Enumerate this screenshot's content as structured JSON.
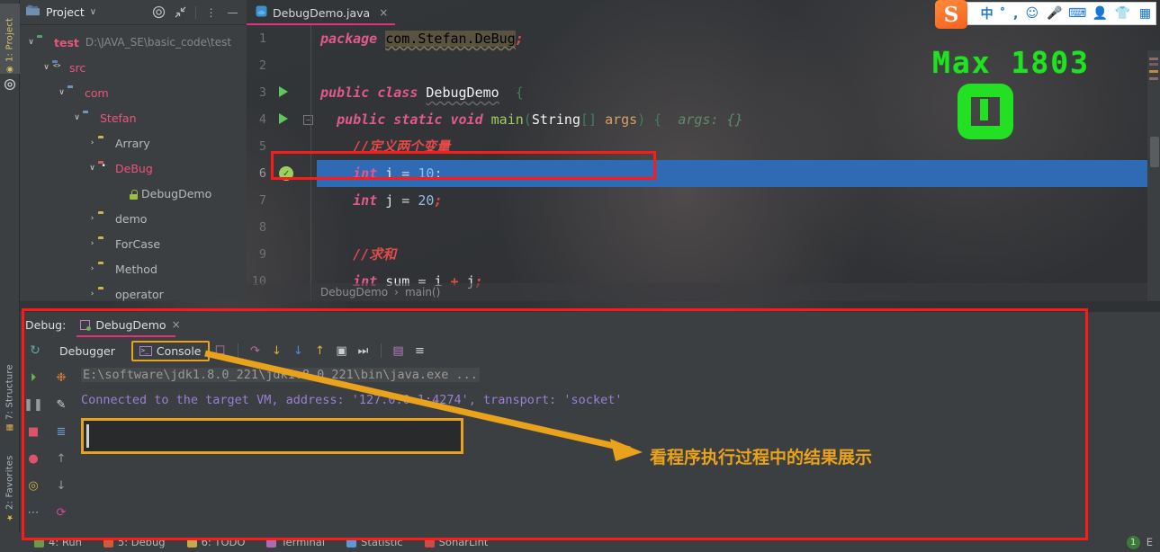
{
  "left_strip": {
    "tabs": [
      {
        "label": "1: Project",
        "icon": "project-icon"
      },
      {
        "label": "7: Structure",
        "icon": "structure-icon"
      },
      {
        "label": "2: Favorites",
        "icon": "star-icon"
      }
    ]
  },
  "project_panel": {
    "title": "Project",
    "caret": "∨",
    "header_icons": [
      "target-icon",
      "collapse-all-icon",
      "more-options-icon",
      "hide-icon"
    ],
    "tree": [
      {
        "arrow": "∨",
        "icon": "folder-green",
        "label": "test",
        "sub": "D:\\JAVA_SE\\basic_code\\test",
        "indent": 0,
        "color": "c-test"
      },
      {
        "arrow": "∨",
        "icon": "folder-src",
        "label": "src",
        "sub": "",
        "indent": 1,
        "color": "c-src"
      },
      {
        "arrow": "∨",
        "icon": "folder-blue",
        "label": "com",
        "sub": "",
        "indent": 2,
        "color": "c-com"
      },
      {
        "arrow": "∨",
        "icon": "folder-blue",
        "label": "Stefan",
        "sub": "",
        "indent": 3,
        "color": "c-stefan"
      },
      {
        "arrow": "›",
        "icon": "folder-yellow",
        "label": "Arrary",
        "sub": "",
        "indent": 4,
        "color": "c-plain"
      },
      {
        "arrow": "∨",
        "icon": "folder-red",
        "label": "DeBug",
        "sub": "",
        "indent": 4,
        "color": "c-debug"
      },
      {
        "arrow": "",
        "icon": "java-class",
        "label": "DebugDemo",
        "sub": "",
        "indent": 5,
        "color": "c-grey",
        "lock": true
      },
      {
        "arrow": "›",
        "icon": "folder-yellow",
        "label": "demo",
        "sub": "",
        "indent": 4,
        "color": "c-plain"
      },
      {
        "arrow": "›",
        "icon": "folder-yellow",
        "label": "ForCase",
        "sub": "",
        "indent": 4,
        "color": "c-plain"
      },
      {
        "arrow": "›",
        "icon": "folder-yellow",
        "label": "Method",
        "sub": "",
        "indent": 4,
        "color": "c-plain"
      },
      {
        "arrow": "›",
        "icon": "folder-yellow",
        "label": "operator",
        "sub": "",
        "indent": 4,
        "color": "c-plain"
      }
    ]
  },
  "editor": {
    "tab": {
      "label": "DebugDemo.java",
      "close": "×",
      "icon": "java-file-icon"
    },
    "breadcrumb": {
      "class": "DebugDemo",
      "sep": "›",
      "method": "main()"
    },
    "current_line": 6,
    "lines": [
      {
        "n": "1",
        "gutter": "",
        "tokens": [
          {
            "t": "package",
            "c": "kw"
          },
          {
            "t": " ",
            "c": "punc"
          },
          {
            "t": "com.Stefan.DeBug",
            "c": "pkg-hl"
          },
          {
            "t": ";",
            "c": "cmt"
          }
        ]
      },
      {
        "n": "2",
        "gutter": "",
        "tokens": []
      },
      {
        "n": "3",
        "gutter": "run",
        "tokens": [
          {
            "t": "public",
            "c": "kw"
          },
          {
            "t": " ",
            "c": "punc"
          },
          {
            "t": "class",
            "c": "kw"
          },
          {
            "t": " ",
            "c": "punc"
          },
          {
            "t": "DebugDemo",
            "c": "cls wavy"
          },
          {
            "t": "  ",
            "c": "punc"
          },
          {
            "t": "{",
            "c": "paren"
          }
        ]
      },
      {
        "n": "4",
        "gutter": "run-fold",
        "tokens": [
          {
            "t": "  ",
            "c": "punc"
          },
          {
            "t": "public",
            "c": "kw"
          },
          {
            "t": " ",
            "c": "punc"
          },
          {
            "t": "static",
            "c": "kw"
          },
          {
            "t": " ",
            "c": "punc"
          },
          {
            "t": "void",
            "c": "kw"
          },
          {
            "t": " ",
            "c": "punc"
          },
          {
            "t": "main",
            "c": "meth"
          },
          {
            "t": "(",
            "c": "paren"
          },
          {
            "t": "String",
            "c": "cls"
          },
          {
            "t": "[]",
            "c": "paren"
          },
          {
            "t": " ",
            "c": "punc"
          },
          {
            "t": "args",
            "c": "param"
          },
          {
            "t": ")",
            "c": "paren"
          },
          {
            "t": " {",
            "c": "paren"
          },
          {
            "t": "  args: {}",
            "c": "hint"
          }
        ]
      },
      {
        "n": "5",
        "gutter": "",
        "tokens": [
          {
            "t": "    ",
            "c": "punc"
          },
          {
            "t": "//定义两个变量",
            "c": "cmt"
          }
        ]
      },
      {
        "n": "6",
        "gutter": "check",
        "hl": true,
        "tokens": [
          {
            "t": "    ",
            "c": "punc"
          },
          {
            "t": "int",
            "c": "kw"
          },
          {
            "t": " ",
            "c": "punc"
          },
          {
            "t": "i",
            "c": "var"
          },
          {
            "t": " = ",
            "c": "punc"
          },
          {
            "t": "10",
            "c": "num"
          },
          {
            "t": ";",
            "c": "punc"
          }
        ]
      },
      {
        "n": "7",
        "gutter": "",
        "tokens": [
          {
            "t": "    ",
            "c": "punc"
          },
          {
            "t": "int",
            "c": "kw"
          },
          {
            "t": " ",
            "c": "punc"
          },
          {
            "t": "j",
            "c": "var"
          },
          {
            "t": " = ",
            "c": "punc"
          },
          {
            "t": "20",
            "c": "num"
          },
          {
            "t": ";",
            "c": "cmt"
          }
        ]
      },
      {
        "n": "8",
        "gutter": "",
        "tokens": []
      },
      {
        "n": "9",
        "gutter": "",
        "tokens": [
          {
            "t": "    ",
            "c": "punc"
          },
          {
            "t": "//求和",
            "c": "cmt"
          }
        ]
      },
      {
        "n": "10",
        "gutter": "",
        "tokens": [
          {
            "t": "    ",
            "c": "punc"
          },
          {
            "t": "int",
            "c": "kw"
          },
          {
            "t": " ",
            "c": "punc"
          },
          {
            "t": "sum",
            "c": "var"
          },
          {
            "t": " = ",
            "c": "punc"
          },
          {
            "t": "i",
            "c": "var"
          },
          {
            "t": " + ",
            "c": "cmt"
          },
          {
            "t": "j",
            "c": "var"
          },
          {
            "t": ";",
            "c": "cmt"
          }
        ]
      }
    ]
  },
  "overlay": {
    "max_label": "Max  1803",
    "max_color": "#22e022"
  },
  "ime": {
    "logo": "S",
    "items": [
      "中",
      "゜,",
      "smiley-icon",
      "mic-icon",
      "keyboard-icon",
      "user-card-icon",
      "shirt-icon",
      "apps-icon"
    ]
  },
  "debug": {
    "label": "Debug:",
    "config_name": "DebugDemo",
    "close": "×",
    "tabs": [
      {
        "label": "Debugger",
        "selected": false
      },
      {
        "label": "Console",
        "selected": true
      }
    ],
    "toolbar_icons": [
      "rerun-icon",
      "stop-paint-icon",
      "step-over-icon",
      "step-into-icon",
      "force-step-into-icon",
      "step-out-icon",
      "run-to-cursor-icon",
      "resume-icon",
      "console-icon",
      "settings-icon"
    ],
    "rail_left": [
      "resume-program-icon",
      "pause-program-icon",
      "stop-icon",
      "view-breakpoints-icon",
      "mute-breakpoints-icon",
      "more-icon"
    ],
    "rail_right": [
      "evaluate-icon",
      "edit-icon",
      "sort-icon",
      "up-icon",
      "down-icon",
      "soft-wrap-icon",
      "more-icon"
    ],
    "console": {
      "command": "E:\\software\\jdk1.8.0_221\\jdk1.8.0_221\\bin\\java.exe ...",
      "vm_message": "Connected to the target VM, address: '127.0.0.1:4274', transport: 'socket'",
      "input_value": "",
      "input_placeholder": ""
    }
  },
  "annotation": {
    "text": "看程序执行过程中的结果展示",
    "arrow_color": "#e8a21c",
    "box_color": "#ff1a1a"
  },
  "statusbar": {
    "items": [
      {
        "label": "4: Run",
        "icon": "run-icon"
      },
      {
        "label": "5: Debug",
        "icon": "debug-icon"
      },
      {
        "label": "6: TODO",
        "icon": "todo-icon"
      },
      {
        "label": "Terminal",
        "icon": "terminal-icon"
      },
      {
        "label": "Statistic",
        "icon": "statistic-icon"
      },
      {
        "label": "SonarLint",
        "icon": "sonarlint-icon"
      }
    ],
    "right_badge": "1",
    "right_label": "E"
  }
}
